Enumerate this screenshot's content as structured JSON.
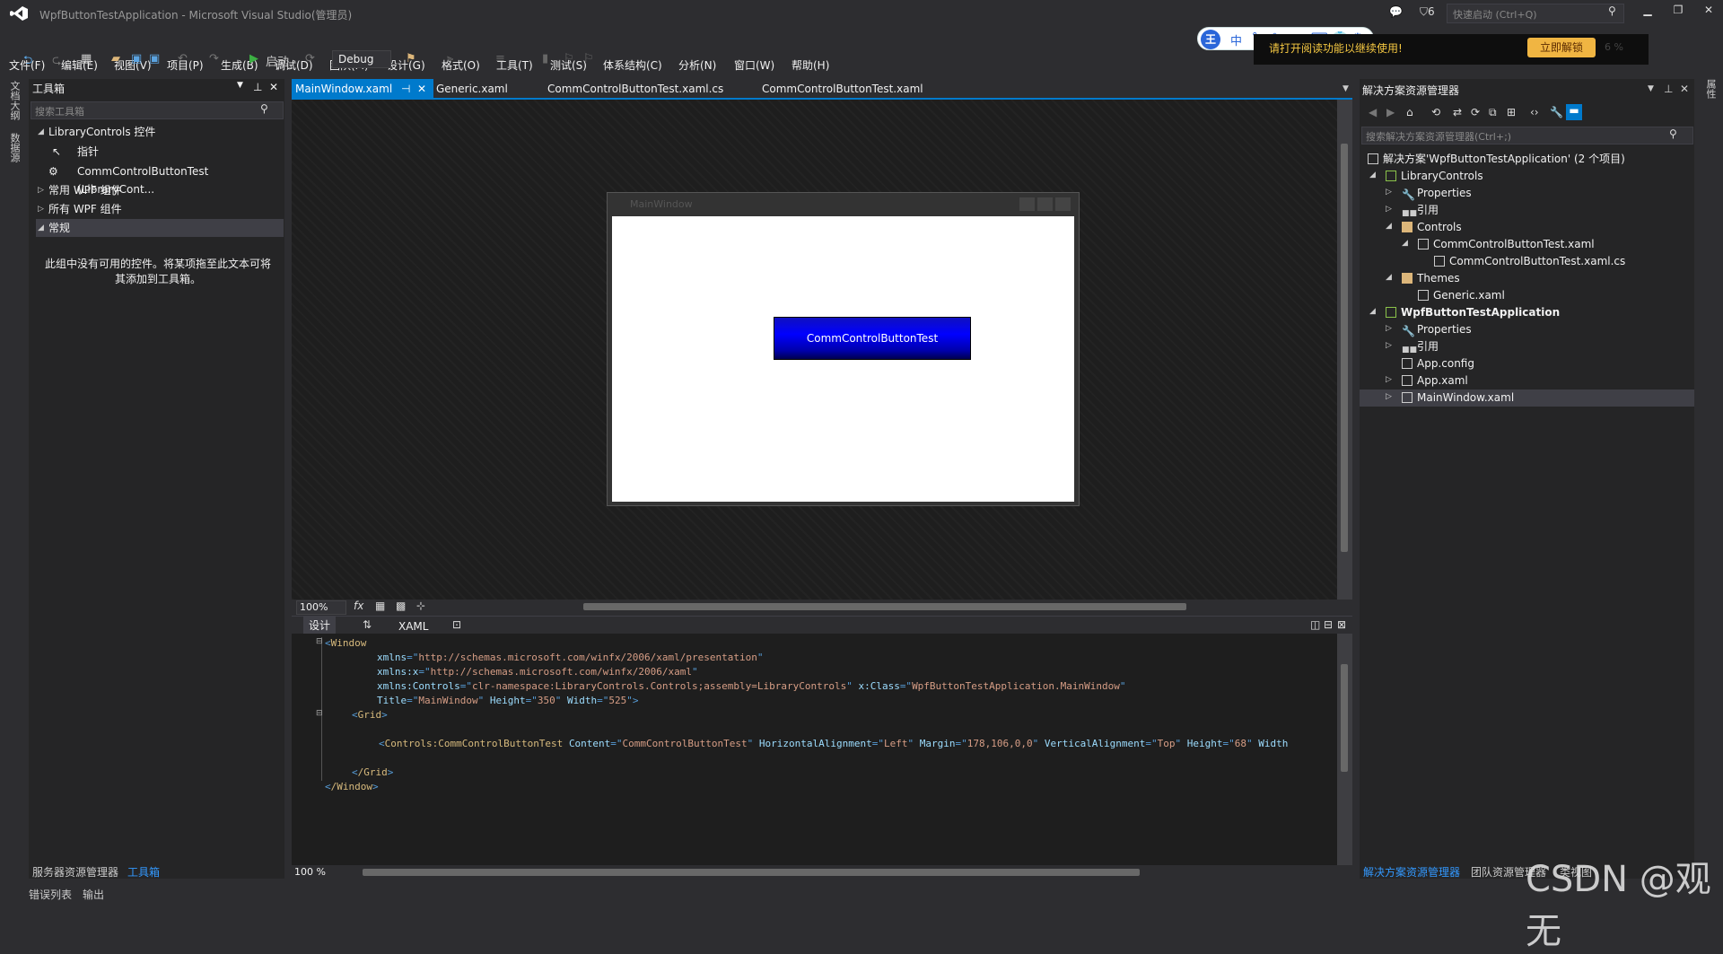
{
  "titlebar": {
    "title": "WpfButtonTestApplication - Microsoft Visual Studio(管理员)",
    "notifications": "6",
    "quick_launch": "快速启动 (Ctrl+Q)"
  },
  "menu": [
    "文件(F)",
    "编辑(E)",
    "视图(V)",
    "项目(P)",
    "生成(B)",
    "调试(D)",
    "团队(M)",
    "设计(G)",
    "格式(O)",
    "工具(T)",
    "测试(S)",
    "体系结构(C)",
    "分析(N)",
    "窗口(W)",
    "帮助(H)"
  ],
  "ime": {
    "logo": "王",
    "mode": "中",
    "banner": "请打开阅读功能以继续使用!",
    "unlock": "立即解锁",
    "percent": "6 %"
  },
  "toolbar": {
    "start": "启动",
    "config": "Debug"
  },
  "leftstrip": {
    "tab1": "文档大纲",
    "tab2": "数据源"
  },
  "toolbox": {
    "title": "工具箱",
    "search": "搜索工具箱",
    "items": [
      "LibraryControls 控件",
      "指针",
      "CommControlButtonTest (LibraryCont...",
      "常用 WPF 组件",
      "所有 WPF 组件",
      "常规"
    ],
    "empty": "此组中没有可用的控件。将某项拖至此文本可将其添加到工具箱。",
    "bottom_tabs": [
      "服务器资源管理器",
      "工具箱"
    ]
  },
  "status_tabs": [
    "错误列表",
    "输出"
  ],
  "doc_tabs": [
    "MainWindow.xaml",
    "Generic.xaml",
    "CommControlButtonTest.xaml.cs",
    "CommControlButtonTest.xaml"
  ],
  "designer": {
    "window_title": "MainWindow",
    "button_label": "CommControlButtonTest",
    "zoom": "100%",
    "fx": "fx"
  },
  "split": {
    "design": "设计",
    "xaml": "XAML"
  },
  "xaml": {
    "l1": "Window",
    "l2a": "xmlns",
    "l2b": "http://schemas.microsoft.com/winfx/2006/xaml/presentation",
    "l3a": "xmlns:x",
    "l3b": "http://schemas.microsoft.com/winfx/2006/xaml",
    "l4a": "xmlns:Controls",
    "l4b": "clr-namespace:LibraryControls.Controls;assembly=LibraryControls",
    "l4c": "x:Class",
    "l4d": "WpfButtonTestApplication.MainWindow",
    "l5a": "Title",
    "l5b": "MainWindow",
    "l5c": "Height",
    "l5d": "350",
    "l5e": "Width",
    "l5f": "525",
    "l6": "Grid",
    "l7a": "Controls:CommControlButtonTest",
    "l7b": "Content",
    "l7c": "CommControlButtonTest",
    "l7d": "HorizontalAlignment",
    "l7e": "Left",
    "l7f": "Margin",
    "l7g": "178,106,0,0",
    "l7h": "VerticalAlignment",
    "l7i": "Top",
    "l7j": "Height",
    "l7k": "68",
    "l7l": "Width",
    "l8": "/Grid",
    "l9": "/Window",
    "zoom": "100 %"
  },
  "solution": {
    "title": "解决方案资源管理器",
    "search": "搜索解决方案资源管理器(Ctrl+;)",
    "items": [
      "解决方案'WpfButtonTestApplication' (2 个项目)",
      "LibraryControls",
      "Properties",
      "引用",
      "Controls",
      "CommControlButtonTest.xaml",
      "CommControlButtonTest.xaml.cs",
      "Themes",
      "Generic.xaml",
      "WpfButtonTestApplication",
      "Properties",
      "引用",
      "App.config",
      "App.xaml",
      "MainWindow.xaml"
    ],
    "bottom_tabs": [
      "解决方案资源管理器",
      "团队资源管理器",
      "类视图"
    ]
  },
  "watermark": "CSDN @观无"
}
